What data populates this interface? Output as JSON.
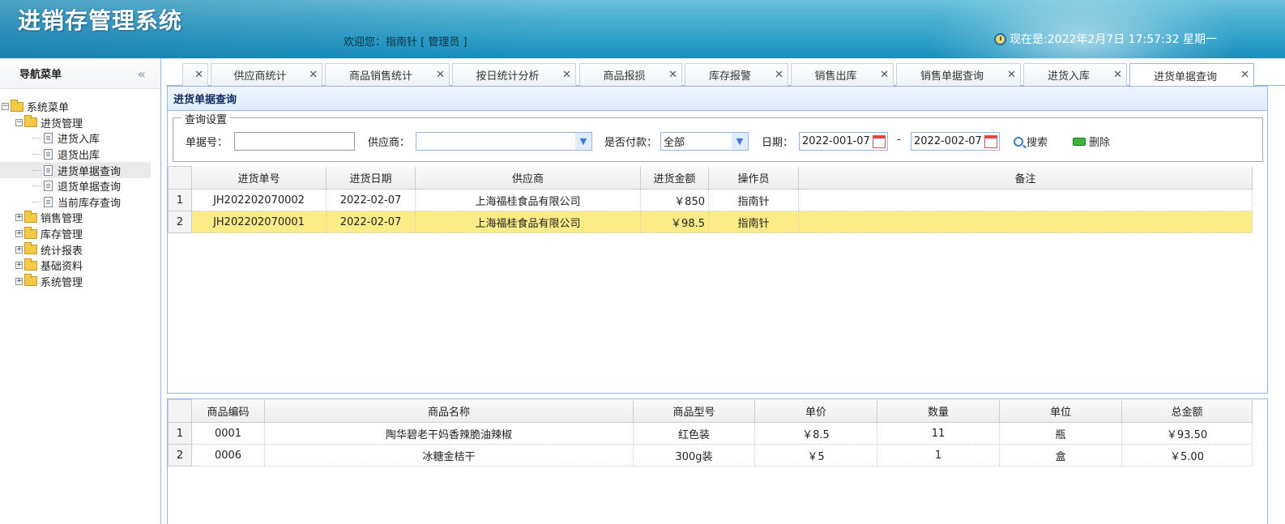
{
  "header": {
    "app_title": "进销存管理系统",
    "welcome": "欢迎您：指南针 [ 管理员 ]",
    "clock": "现在是:2022年2月7日 17:57:32 星期一"
  },
  "nav": {
    "title": "导航菜单",
    "collapse_glyph": "«",
    "tree": {
      "root": "系统菜单",
      "groups": [
        {
          "label": "进货管理",
          "expanded": true,
          "items": [
            "进货入库",
            "退货出库",
            "进货单据查询",
            "退货单据查询",
            "当前库存查询"
          ]
        },
        {
          "label": "销售管理",
          "expanded": false
        },
        {
          "label": "库存管理",
          "expanded": false
        },
        {
          "label": "统计报表",
          "expanded": false
        },
        {
          "label": "基础资料",
          "expanded": false
        },
        {
          "label": "系统管理",
          "expanded": false
        }
      ],
      "selected_item": "进货单据查询"
    }
  },
  "tabs": [
    {
      "label": ""
    },
    {
      "label": "供应商统计"
    },
    {
      "label": "商品销售统计"
    },
    {
      "label": "按日统计分析"
    },
    {
      "label": "商品报损"
    },
    {
      "label": "库存报警"
    },
    {
      "label": "销售出库"
    },
    {
      "label": "销售单据查询"
    },
    {
      "label": "进货入库"
    },
    {
      "label": "进货单据查询",
      "active": true
    }
  ],
  "tab_close_glyph": "✕",
  "panel": {
    "title": "进货单据查询",
    "query": {
      "legend": "查询设置",
      "bill_no_label": "单据号：",
      "bill_no_value": "",
      "supplier_label": "供应商：",
      "supplier_value": "",
      "paid_label": "是否付款：",
      "paid_value": "全部",
      "date_label": "日期：",
      "date_from": "2022-001-07",
      "date_sep": "-",
      "date_to": "2022-002-07",
      "search_label": "搜索",
      "delete_label": "删除"
    },
    "grid": {
      "columns": [
        "进货单号",
        "进货日期",
        "供应商",
        "进货金额",
        "操作员",
        "备注"
      ],
      "rows": [
        {
          "rn": "1",
          "no": "JH202202070002",
          "date": "2022-02-07",
          "supplier": "上海福桂食品有限公司",
          "amount": "￥850",
          "operator": "指南针",
          "note": ""
        },
        {
          "rn": "2",
          "no": "JH202202070001",
          "date": "2022-02-07",
          "supplier": "上海福桂食品有限公司",
          "amount": "￥98.5",
          "operator": "指南针",
          "note": "",
          "selected": true
        }
      ]
    }
  },
  "detail_grid": {
    "columns": [
      "商品编码",
      "商品名称",
      "商品型号",
      "单价",
      "数量",
      "单位",
      "总金额"
    ],
    "rows": [
      {
        "rn": "1",
        "code": "0001",
        "name": "陶华碧老干妈香辣脆油辣椒",
        "model": "红色装",
        "price": "￥8.5",
        "qty": "11",
        "unit": "瓶",
        "total": "￥93.50"
      },
      {
        "rn": "2",
        "code": "0006",
        "name": "冰糖金桔干",
        "model": "300g装",
        "price": "￥5",
        "qty": "1",
        "unit": "盒",
        "total": "￥5.00"
      }
    ]
  },
  "colors": {
    "header_blue": "#2c9fc8",
    "panel_border": "#95b8e7",
    "selected_row": "#fbec88"
  }
}
